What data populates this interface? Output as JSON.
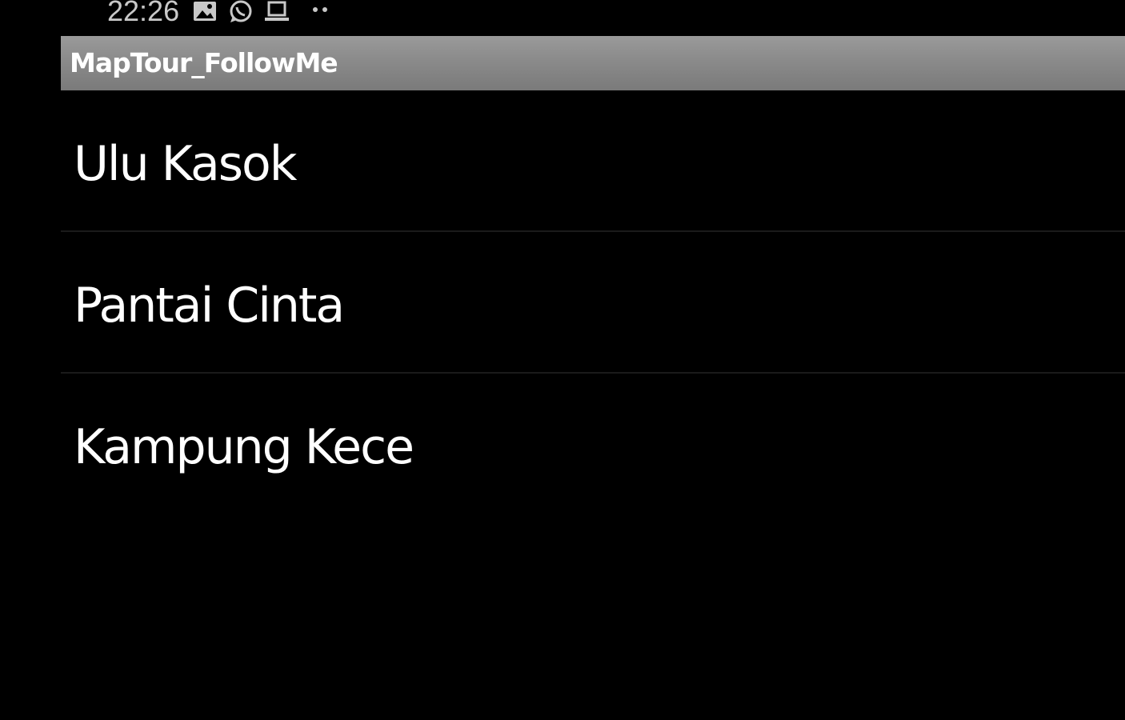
{
  "status_bar": {
    "time": "22:26",
    "icons": [
      "gallery-icon",
      "whatsapp-icon",
      "laptop-icon",
      "more-dots-icon"
    ]
  },
  "app_bar": {
    "title": "MapTour_FollowMe"
  },
  "list": {
    "items": [
      {
        "label": "Ulu Kasok"
      },
      {
        "label": "Pantai Cinta"
      },
      {
        "label": "Kampung Kece"
      }
    ]
  },
  "colors": {
    "background": "#000000",
    "title_bar": "#8c8c8c",
    "text": "#ffffff",
    "divider": "#1a1a1a"
  }
}
